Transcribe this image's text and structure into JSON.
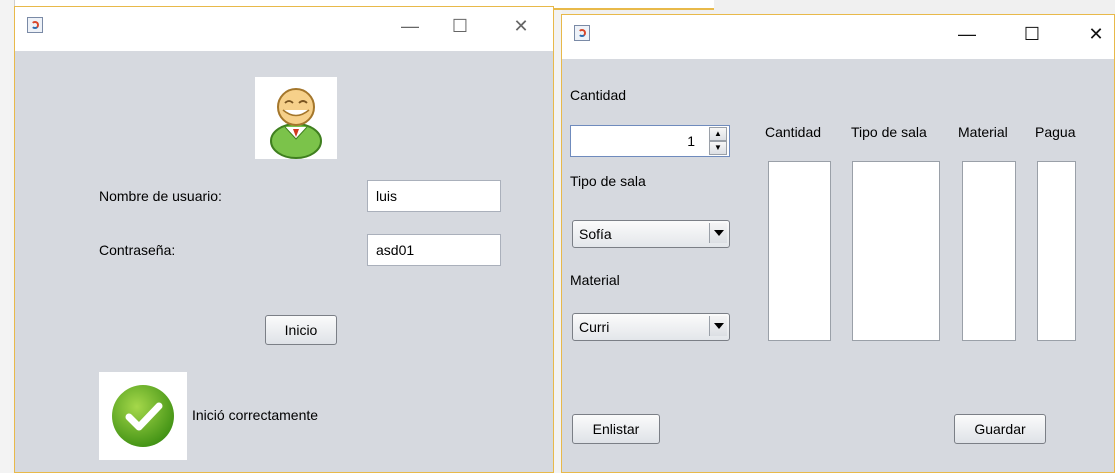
{
  "login_window": {
    "controls": {
      "minimize": "—",
      "maximize": "☐",
      "close": "✕"
    },
    "username_label": "Nombre de usuario:",
    "username_value": "luis",
    "password_label": "Contraseña:",
    "password_value": "asd01",
    "login_button": "Inicio",
    "status_text": "Inició correctamente",
    "icons": {
      "app": "java-app-icon",
      "user": "user-avatar-icon",
      "success": "green-check-icon"
    }
  },
  "order_window": {
    "controls": {
      "minimize": "—",
      "maximize": "☐",
      "close": "✕"
    },
    "cantidad_label": "Cantidad",
    "cantidad_value": "1",
    "tipo_label": "Tipo de sala",
    "tipo_selected": "Sofía",
    "material_label": "Material",
    "material_selected": "Curri",
    "columns": [
      "Cantidad",
      "Tipo de sala",
      "Material",
      "Pagua"
    ],
    "enlistar_button": "Enlistar",
    "guardar_button": "Guardar"
  }
}
